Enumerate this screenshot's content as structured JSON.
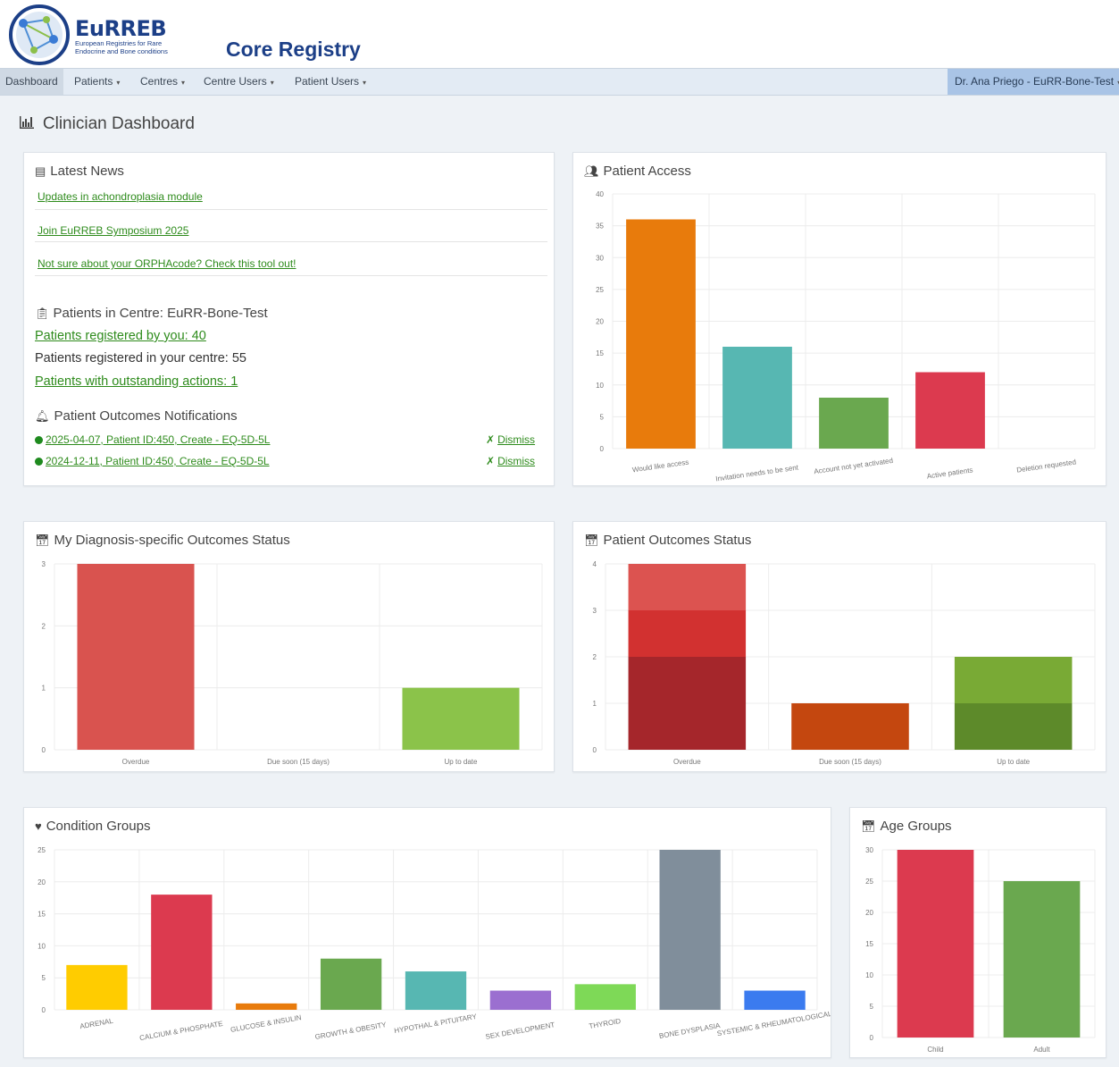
{
  "brand": {
    "name": "EuRREB",
    "subtitle_line1": "European Registries for Rare",
    "subtitle_line2": "Endocrine and Bone conditions",
    "app_title": "Core Registry"
  },
  "nav": {
    "items": [
      {
        "label": "Dashboard"
      },
      {
        "label": "Patients"
      },
      {
        "label": "Centres"
      },
      {
        "label": "Centre Users"
      },
      {
        "label": "Patient Users"
      }
    ],
    "caret": "▾",
    "user": "Dr. Ana Priego - EuRR-Bone-Test"
  },
  "dashboard_title": "Clinician Dashboard",
  "news": {
    "title": "Latest News",
    "items": [
      "Updates in achondroplasia module",
      "Join EuRREB Symposium 2025",
      "Not sure about your ORPHAcode? Check this tool out!"
    ]
  },
  "centre": {
    "title": "Patients in Centre: EuRR-Bone-Test",
    "by_you": "Patients registered by you: 40",
    "in_centre": "Patients registered in your centre: 55",
    "outstanding": "Patients with outstanding actions: 1"
  },
  "notifications": {
    "title": "Patient Outcomes Notifications",
    "items": [
      {
        "text": "2025-04-07, Patient ID:450, Create - EQ-5D-5L",
        "action": "Dismiss"
      },
      {
        "text": "2024-12-11, Patient ID:450, Create - EQ-5D-5L",
        "action": "Dismiss"
      }
    ]
  },
  "panels": {
    "patient_access": "Patient Access",
    "diagnosis_outcomes": "My Diagnosis-specific Outcomes Status",
    "patient_outcomes": "Patient Outcomes Status",
    "condition_groups": "Condition Groups",
    "age_groups": "Age Groups"
  },
  "colors": {
    "brand": "#1c3f87",
    "link": "#2e8b1c",
    "nav_bg": "#e3ebf4",
    "user_bg": "#a9c4e6"
  },
  "chart_data": [
    {
      "id": "patient_access",
      "type": "bar",
      "categories": [
        "Would like access",
        "Invitation needs to be sent",
        "Account not yet activated",
        "Active patients",
        "Deletion requested"
      ],
      "values": [
        36,
        16,
        8,
        12,
        0
      ],
      "colors": [
        "#e87b0c",
        "#57b7b2",
        "#6aa84f",
        "#dc3a4f",
        "#888888"
      ],
      "ylim": [
        0,
        40
      ],
      "yticks": [
        0,
        5,
        10,
        15,
        20,
        25,
        30,
        35,
        40
      ],
      "grid": true
    },
    {
      "id": "diagnosis_outcomes",
      "type": "bar",
      "categories": [
        "Overdue",
        "Due soon (15 days)",
        "Up to date"
      ],
      "values": [
        3,
        0,
        1
      ],
      "colors": [
        "#d9534f",
        "#f0ad4e",
        "#8bc34a"
      ],
      "ylim": [
        0,
        3
      ],
      "yticks": [
        0,
        1,
        2,
        3
      ],
      "grid": true
    },
    {
      "id": "patient_outcomes",
      "type": "bar",
      "stacked": true,
      "categories": [
        "Overdue",
        "Due soon (15 days)",
        "Up to date"
      ],
      "series": [
        {
          "values": [
            2,
            1,
            1
          ],
          "colors": [
            "#a5262b",
            "#c4470f",
            "#5d8a2a"
          ]
        },
        {
          "values": [
            1,
            0,
            1
          ],
          "colors": [
            "#d23130",
            "#c4470f",
            "#79aa35"
          ]
        },
        {
          "values": [
            1,
            0,
            0
          ],
          "colors": [
            "#dc5350",
            "#c4470f",
            "#79aa35"
          ]
        }
      ],
      "ylim": [
        0,
        4
      ],
      "yticks": [
        0,
        1,
        2,
        3,
        4
      ],
      "grid": true
    },
    {
      "id": "condition_groups",
      "type": "bar",
      "categories": [
        "ADRENAL",
        "CALCIUM & PHOSPHATE",
        "GLUCOSE & INSULIN",
        "GROWTH & OBESITY",
        "HYPOTHAL & PITUITARY",
        "SEX DEVELOPMENT",
        "THYROID",
        "BONE DYSPLASIA",
        "SYSTEMIC & RHEUMATOLOGICAL"
      ],
      "values": [
        7,
        18,
        1,
        8,
        6,
        3,
        4,
        25,
        3
      ],
      "colors": [
        "#ffcc00",
        "#dc3a4f",
        "#e87b0c",
        "#6aa84f",
        "#57b7b2",
        "#9b6fd0",
        "#7ed957",
        "#808e9b",
        "#3b7bef"
      ],
      "ylim": [
        0,
        25
      ],
      "yticks": [
        0,
        5,
        10,
        15,
        20,
        25
      ],
      "grid": true
    },
    {
      "id": "age_groups",
      "type": "bar",
      "categories": [
        "Child",
        "Adult"
      ],
      "values": [
        30,
        25
      ],
      "colors": [
        "#dc3a4f",
        "#6aa84f"
      ],
      "ylim": [
        0,
        30
      ],
      "yticks": [
        0,
        5,
        10,
        15,
        20,
        25,
        30
      ],
      "grid": true
    }
  ]
}
